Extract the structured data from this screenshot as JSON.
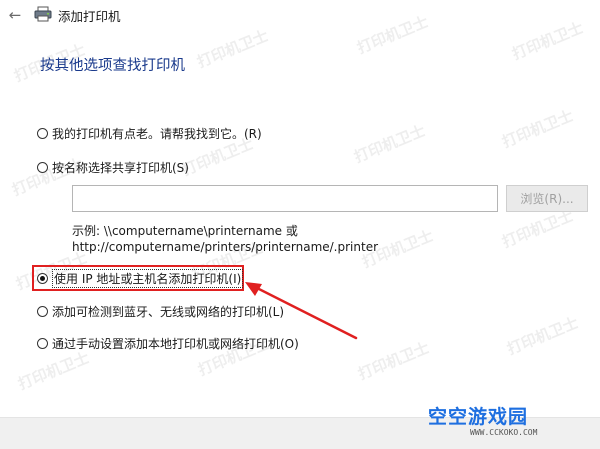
{
  "window": {
    "title": "添加打印机"
  },
  "heading": "按其他选项查找打印机",
  "options": [
    {
      "label": "我的打印机有点老。请帮我找到它。(R)",
      "checked": false
    },
    {
      "label": "按名称选择共享打印机(S)",
      "checked": false
    },
    {
      "label": "使用 IP 地址或主机名添加打印机(I)",
      "checked": true
    },
    {
      "label": "添加可检测到蓝牙、无线或网络的打印机(L)",
      "checked": false
    },
    {
      "label": "通过手动设置添加本地打印机或网络打印机(O)",
      "checked": false
    }
  ],
  "share_input": {
    "value": ""
  },
  "browse_label": "浏览(R)...",
  "example": {
    "line1": "示例: \\\\computername\\printername 或",
    "line2": "http://computername/printers/printername/.printer"
  },
  "watermark_text": "打印机卫士",
  "brand": {
    "name": "空空游戏园",
    "url": "WWW.CCKOKO.COM"
  },
  "colors": {
    "heading": "#1a3a8c",
    "highlight": "#e02020",
    "brand": "#1e6fe0"
  },
  "icons": {
    "back": "back-arrow-icon",
    "printer": "printer-icon"
  }
}
